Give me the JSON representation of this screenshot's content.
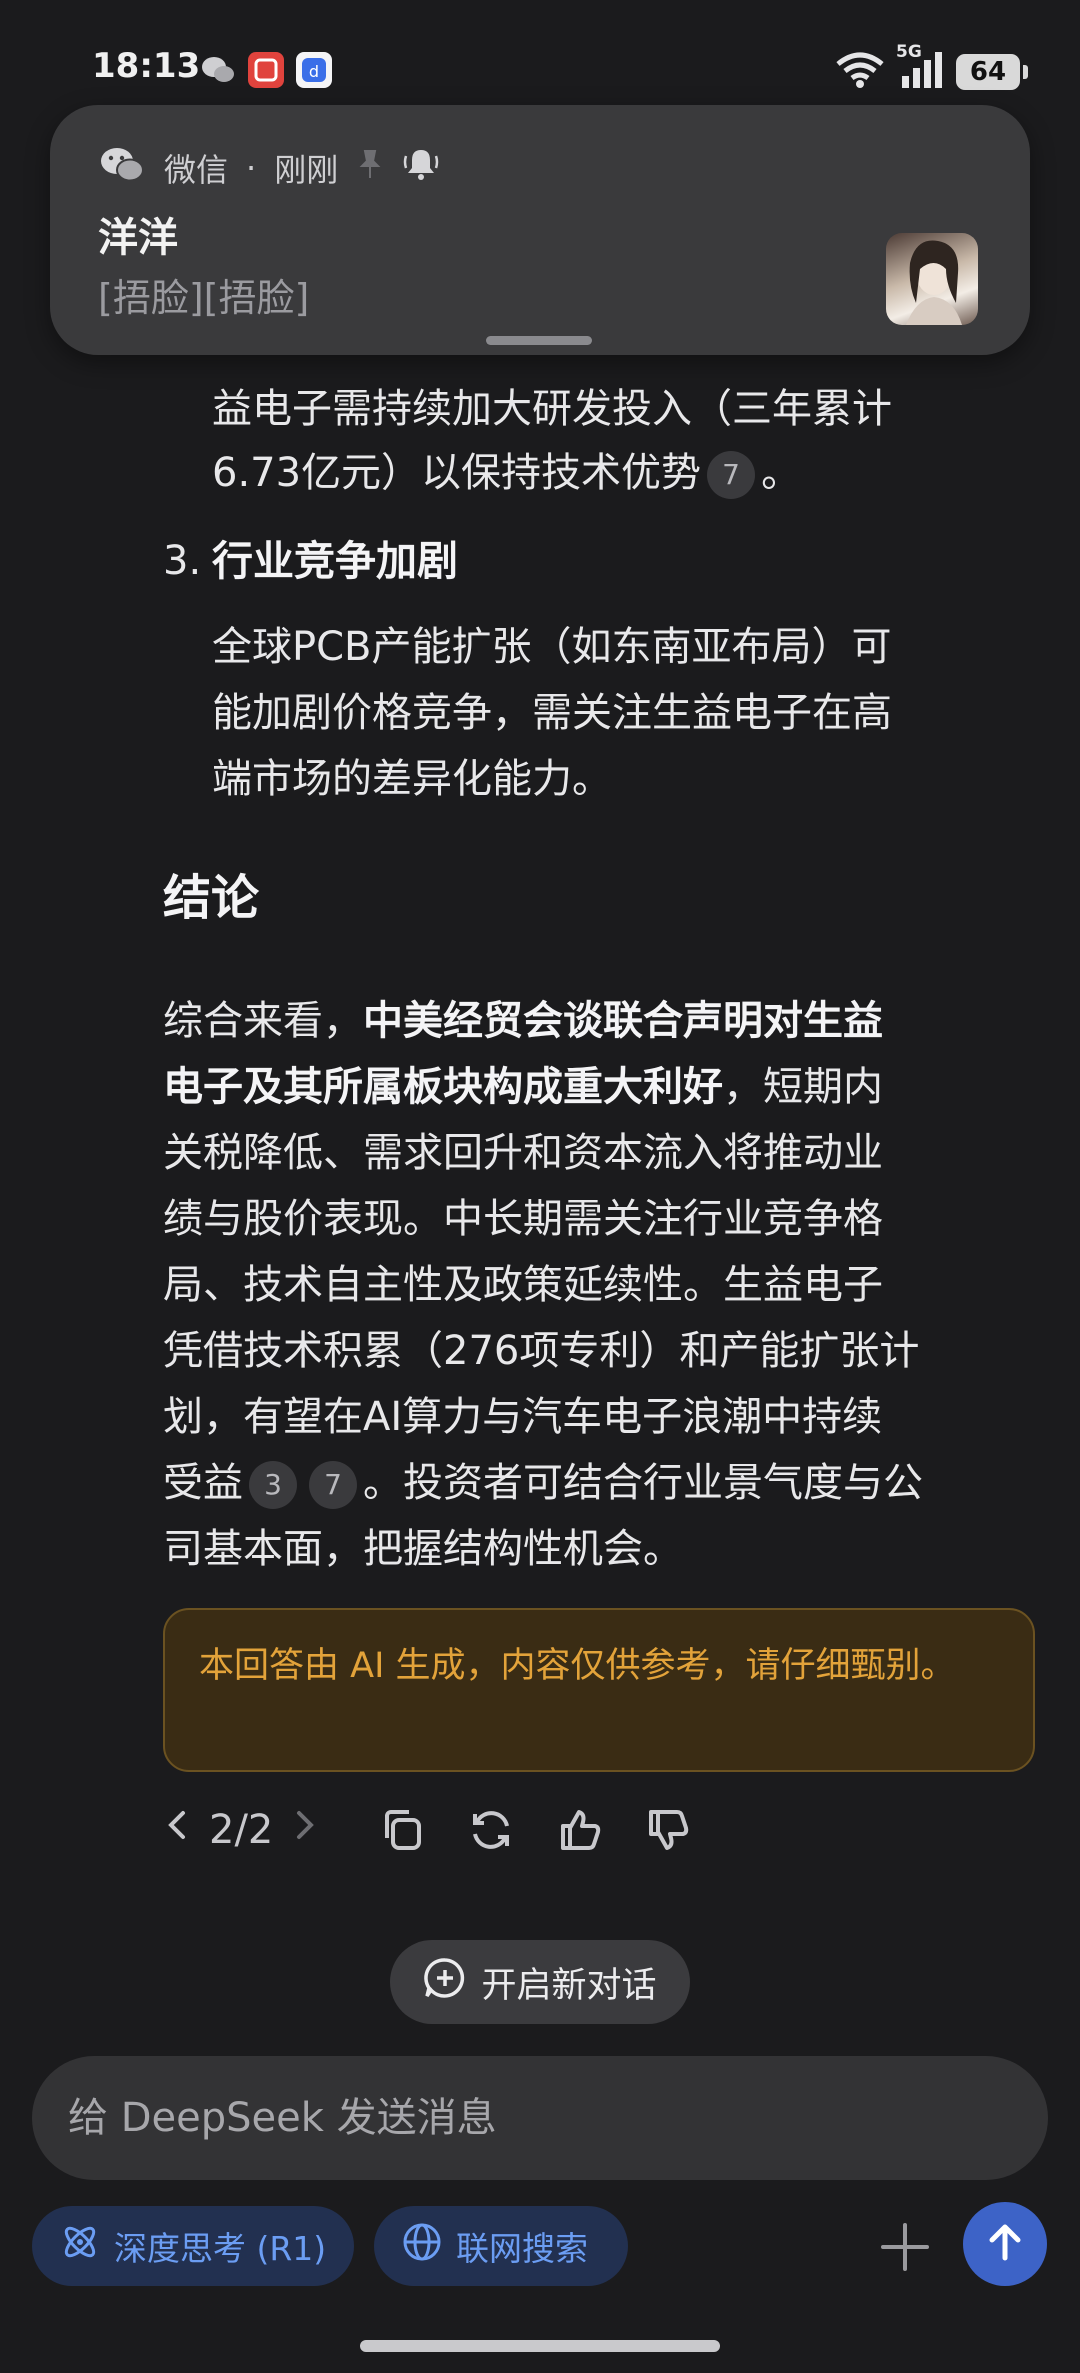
{
  "status_bar": {
    "time": "18:13",
    "network": "5G",
    "battery": "64"
  },
  "notification": {
    "app": "微信",
    "separator": "·",
    "when": "刚刚",
    "title": "洋洋",
    "message": "[捂脸][捂脸]"
  },
  "article": {
    "para_top": {
      "line1": "益电子需持续加大研发投入（三年累计",
      "line2_text": "6.73亿元）以保持技术优势",
      "line2_cite": "7",
      "line2_end": "。"
    },
    "item3": {
      "number": "3.",
      "heading": "行业竞争加剧",
      "lines": [
        "全球PCB产能扩张（如东南亚布局）可",
        "能加剧价格竞争，需关注生益电子在高",
        "端市场的差异化能力。"
      ]
    },
    "conclusion_heading": "结论",
    "conclusion": {
      "l1_pre": "综合来看，",
      "l1_bold": "中美经贸会谈联合声明对生益",
      "l2_bold": "电子及其所属板块构成重大利好",
      "l2_post": "，短期内",
      "l3": "关税降低、需求回升和资本流入将推动业",
      "l4": "绩与股价表现。中长期需关注行业竞争格",
      "l5": "局、技术自主性及政策延续性。生益电子",
      "l6": "凭借技术积累（276项专利）和产能扩张计",
      "l7": "划，有望在AI算力与汽车电子浪潮中持续",
      "l8_pre": "受益",
      "l8_cite1": "3",
      "l8_cite2": "7",
      "l8_post": "。投资者可结合行业景气度与公",
      "l9": "司基本面，把握结构性机会。"
    },
    "disclaimer": "本回答由 AI 生成，内容仅供参考，请仔细甄别。"
  },
  "actions": {
    "pager": "2/2"
  },
  "new_chat_label": "开启新对话",
  "composer": {
    "placeholder": "给 DeepSeek 发送消息"
  },
  "chips": {
    "deep_think": "深度思考 (R1)",
    "web_search": "联网搜索"
  },
  "colors": {
    "background": "#1b1b1d",
    "accent_blue": "#3d63c7",
    "disclaimer_text": "#e3a33a"
  }
}
